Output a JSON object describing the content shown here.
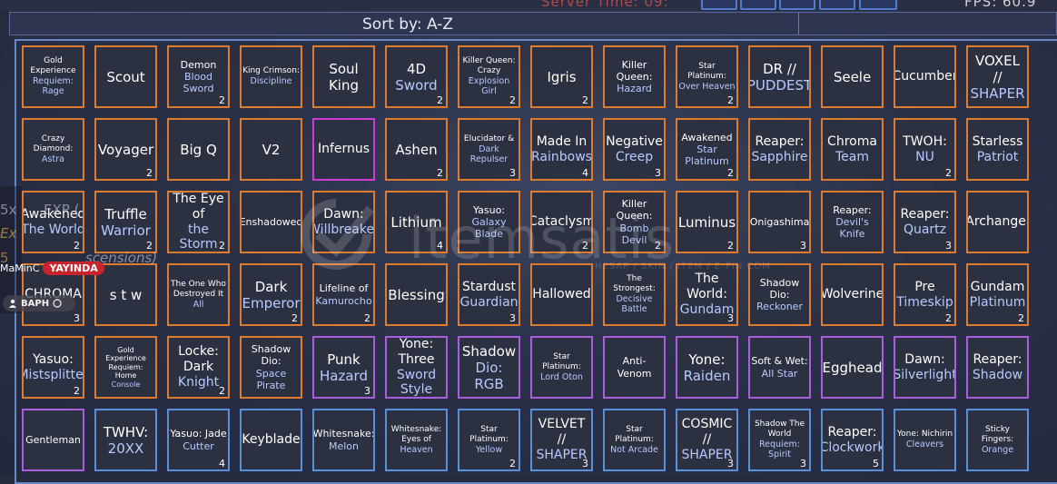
{
  "hud": {
    "server_time": "Server Time: 09:",
    "fps": "FPS: 60.9"
  },
  "sort": {
    "label": "Sort by: A-Z"
  },
  "overlay": {
    "left_lines": [
      "5x",
      "Ex",
      "5"
    ],
    "left_text_1": "EXP (",
    "left_text_2": "scensions)",
    "player_name": "MaMinC",
    "player_badge": "YAYINDA",
    "pill_text": "BAPH"
  },
  "watermark": {
    "brand": "itemsatis",
    "sub": "HESAP / SKIN / ITEM / E-PIN COM"
  },
  "colors": {
    "orange": "#e07a2c",
    "purple": "#a95ee0",
    "magenta": "#d23ad6",
    "blue": "#5b8fd8"
  },
  "tiles": [
    {
      "l1": "Gold Experience",
      "l2": "Requiem: Rage",
      "c": "",
      "b": "orange",
      "s": "xs"
    },
    {
      "l1": "Scout",
      "l2": "",
      "c": "",
      "b": "orange",
      "s": "lg"
    },
    {
      "l1": "Demon",
      "l2": "Blood Sword",
      "c": "2",
      "b": "orange",
      "s": "sm"
    },
    {
      "l1": "King Crimson:",
      "l2": "Discipline",
      "c": "",
      "b": "orange",
      "s": "xs"
    },
    {
      "l1": "Soul King",
      "l2": "",
      "c": "",
      "b": "orange",
      "s": "lg"
    },
    {
      "l1": "4D",
      "l2": "Sword",
      "c": "2",
      "b": "orange",
      "s": "lg"
    },
    {
      "l1": "Killer Queen: Crazy",
      "l2": "Explosion Girl",
      "c": "2",
      "b": "orange",
      "s": "xs"
    },
    {
      "l1": "Igris",
      "l2": "",
      "c": "2",
      "b": "orange",
      "s": "lg"
    },
    {
      "l1": "Killer Queen:",
      "l2": "Hazard",
      "c": "",
      "b": "orange",
      "s": "sm"
    },
    {
      "l1": "Star Platinum:",
      "l2": "Over Heaven",
      "c": "2",
      "b": "orange",
      "s": "xs"
    },
    {
      "l1": "DR //",
      "l2": "PUDDEST",
      "c": "",
      "b": "orange",
      "s": "lg"
    },
    {
      "l1": "Seele",
      "l2": "",
      "c": "",
      "b": "orange",
      "s": "lg"
    },
    {
      "l1": "Cucumber",
      "l2": "",
      "c": "",
      "b": "orange",
      "s": "md"
    },
    {
      "l1": "VOXEL //",
      "l2": "SHAPER",
      "c": "",
      "b": "orange",
      "s": "lg"
    },
    {
      "l1": "Crazy Diamond:",
      "l2": "Astra",
      "c": "",
      "b": "orange",
      "s": "xs"
    },
    {
      "l1": "Voyager",
      "l2": "",
      "c": "2",
      "b": "orange",
      "s": "lg"
    },
    {
      "l1": "Big Q",
      "l2": "",
      "c": "",
      "b": "orange",
      "s": "lg"
    },
    {
      "l1": "V2",
      "l2": "",
      "c": "",
      "b": "orange",
      "s": "lg"
    },
    {
      "l1": "Infernus",
      "l2": "",
      "c": "",
      "b": "magenta",
      "s": "md"
    },
    {
      "l1": "Ashen",
      "l2": "",
      "c": "2",
      "b": "orange",
      "s": "lg"
    },
    {
      "l1": "Elucidator &",
      "l2": "Dark Repulser",
      "c": "3",
      "b": "orange",
      "s": "xs"
    },
    {
      "l1": "Made In",
      "l2": "Rainbows",
      "c": "4",
      "b": "orange",
      "s": "md"
    },
    {
      "l1": "Negative",
      "l2": "Creep",
      "c": "3",
      "b": "orange",
      "s": "md"
    },
    {
      "l1": "Awakened",
      "l2": "Star Platinum",
      "c": "2",
      "b": "orange",
      "s": "sm"
    },
    {
      "l1": "Reaper:",
      "l2": "Sapphire",
      "c": "",
      "b": "orange",
      "s": "md"
    },
    {
      "l1": "Chroma",
      "l2": "Team",
      "c": "",
      "b": "orange",
      "s": "md"
    },
    {
      "l1": "TWOH:",
      "l2": "NU",
      "c": "2",
      "b": "orange",
      "s": "md"
    },
    {
      "l1": "Starless",
      "l2": "Patriot",
      "c": "",
      "b": "orange",
      "s": "md"
    },
    {
      "l1": "Awakened",
      "l2": "The World",
      "c": "2",
      "b": "orange",
      "s": "md"
    },
    {
      "l1": "Truffle",
      "l2": "Warrior",
      "c": "2",
      "b": "orange",
      "s": "lg"
    },
    {
      "l1": "The Eye of",
      "l2": "the Storm",
      "c": "2",
      "b": "orange",
      "s": "md"
    },
    {
      "l1": "Enshadowed",
      "l2": "",
      "c": "",
      "b": "orange",
      "s": "sm"
    },
    {
      "l1": "Dawn:",
      "l2": "Willbreaker",
      "c": "",
      "b": "orange",
      "s": "md"
    },
    {
      "l1": "Lithium",
      "l2": "",
      "c": "4",
      "b": "orange",
      "s": "lg"
    },
    {
      "l1": "Yasuo:",
      "l2": "Galaxy Blade",
      "c": "",
      "b": "orange",
      "s": "sm"
    },
    {
      "l1": "Cataclysm",
      "l2": "",
      "c": "2",
      "b": "orange",
      "s": "md"
    },
    {
      "l1": "Killer Queen:",
      "l2": "Bomb Devil",
      "c": "2",
      "b": "orange",
      "s": "sm"
    },
    {
      "l1": "Luminus",
      "l2": "",
      "c": "2",
      "b": "orange",
      "s": "lg"
    },
    {
      "l1": "Onigashima",
      "l2": "",
      "c": "3",
      "b": "orange",
      "s": "sm"
    },
    {
      "l1": "Reaper:",
      "l2": "Devil's Knife",
      "c": "",
      "b": "orange",
      "s": "sm"
    },
    {
      "l1": "Reaper:",
      "l2": "Quartz",
      "c": "3",
      "b": "orange",
      "s": "md"
    },
    {
      "l1": "Archangel",
      "l2": "",
      "c": "",
      "b": "orange",
      "s": "md"
    },
    {
      "l1": "CHROMA",
      "l2": "",
      "c": "3",
      "b": "orange",
      "s": "md"
    },
    {
      "l1": "s t w",
      "l2": "",
      "c": "",
      "b": "orange",
      "s": "lg"
    },
    {
      "l1": "The One Who Destroyed It",
      "l2": "All",
      "c": "",
      "b": "orange",
      "s": "xs"
    },
    {
      "l1": "Dark",
      "l2": "Emperor",
      "c": "2",
      "b": "orange",
      "s": "lg"
    },
    {
      "l1": "Lifeline of",
      "l2": "Kamurocho",
      "c": "2",
      "b": "orange",
      "s": "sm"
    },
    {
      "l1": "Blessing",
      "l2": "",
      "c": "",
      "b": "orange",
      "s": "lg"
    },
    {
      "l1": "Stardust",
      "l2": "Guardian",
      "c": "3",
      "b": "orange",
      "s": "md"
    },
    {
      "l1": "Hallowed",
      "l2": "",
      "c": "",
      "b": "orange",
      "s": "md"
    },
    {
      "l1": "The Strongest:",
      "l2": "Decisive Battle",
      "c": "",
      "b": "orange",
      "s": "xs"
    },
    {
      "l1": "The World:",
      "l2": "Gundam",
      "c": "3",
      "b": "orange",
      "s": "md"
    },
    {
      "l1": "Shadow Dio:",
      "l2": "Reckoner",
      "c": "",
      "b": "orange",
      "s": "sm"
    },
    {
      "l1": "Wolverine",
      "l2": "",
      "c": "",
      "b": "orange",
      "s": "md"
    },
    {
      "l1": "Pre",
      "l2": "Timeskip",
      "c": "2",
      "b": "orange",
      "s": "md"
    },
    {
      "l1": "Gundam",
      "l2": "Platinum",
      "c": "2",
      "b": "orange",
      "s": "md"
    },
    {
      "l1": "Yasuo:",
      "l2": "Mistsplitter",
      "c": "2",
      "b": "orange",
      "s": "md"
    },
    {
      "l1": "Gold Experience Requiem: Home",
      "l2": "Console",
      "c": "",
      "b": "orange",
      "s": "xxs"
    },
    {
      "l1": "Locke: Dark",
      "l2": "Knight",
      "c": "2",
      "b": "orange",
      "s": "md"
    },
    {
      "l1": "Shadow Dio:",
      "l2": "Space Pirate",
      "c": "",
      "b": "orange",
      "s": "sm"
    },
    {
      "l1": "Punk",
      "l2": "Hazard",
      "c": "3",
      "b": "purple",
      "s": "lg"
    },
    {
      "l1": "Yone: Three",
      "l2": "Sword Style",
      "c": "",
      "b": "purple",
      "s": "md"
    },
    {
      "l1": "Shadow",
      "l2": "Dio: RGB",
      "c": "",
      "b": "purple",
      "s": "lg"
    },
    {
      "l1": "Star Platinum:",
      "l2": "Lord Oton",
      "c": "",
      "b": "purple",
      "s": "xs"
    },
    {
      "l1": "Anti-Venom",
      "l2": "",
      "c": "",
      "b": "purple",
      "s": "sm"
    },
    {
      "l1": "Yone:",
      "l2": "Raiden",
      "c": "",
      "b": "purple",
      "s": "lg"
    },
    {
      "l1": "Soft & Wet:",
      "l2": "All Star",
      "c": "",
      "b": "purple",
      "s": "sm"
    },
    {
      "l1": "Egghead",
      "l2": "",
      "c": "",
      "b": "purple",
      "s": "lg"
    },
    {
      "l1": "Dawn:",
      "l2": "Silverlight",
      "c": "",
      "b": "purple",
      "s": "md"
    },
    {
      "l1": "Reaper:",
      "l2": "Shadow",
      "c": "",
      "b": "purple",
      "s": "md"
    },
    {
      "l1": "Gentleman",
      "l2": "",
      "c": "",
      "b": "purple",
      "s": "sm"
    },
    {
      "l1": "TWHV:",
      "l2": "20XX",
      "c": "",
      "b": "blue",
      "s": "lg"
    },
    {
      "l1": "Yasuo: Jade",
      "l2": "Cutter",
      "c": "4",
      "b": "blue",
      "s": "sm"
    },
    {
      "l1": "Keyblade",
      "l2": "",
      "c": "",
      "b": "blue",
      "s": "md"
    },
    {
      "l1": "Whitesnake:",
      "l2": "Melon",
      "c": "",
      "b": "blue",
      "s": "sm"
    },
    {
      "l1": "Whitesnake: Eyes of",
      "l2": "Heaven",
      "c": "",
      "b": "blue",
      "s": "xs"
    },
    {
      "l1": "Star Platinum:",
      "l2": "Yellow",
      "c": "2",
      "b": "blue",
      "s": "xs"
    },
    {
      "l1": "VELVET //",
      "l2": "SHAPER",
      "c": "3",
      "b": "blue",
      "s": "md"
    },
    {
      "l1": "Star Platinum:",
      "l2": "Not Arcade",
      "c": "",
      "b": "blue",
      "s": "xs"
    },
    {
      "l1": "COSMIC //",
      "l2": "SHAPER",
      "c": "3",
      "b": "blue",
      "s": "md"
    },
    {
      "l1": "Shadow The World",
      "l2": "Requiem: Spirit",
      "c": "3",
      "b": "blue",
      "s": "xs"
    },
    {
      "l1": "Reaper:",
      "l2": "Clockwork",
      "c": "5",
      "b": "blue",
      "s": "md"
    },
    {
      "l1": "Yone: Nichirin",
      "l2": "Cleavers",
      "c": "",
      "b": "blue",
      "s": "xs"
    },
    {
      "l1": "Sticky Fingers:",
      "l2": "Orange",
      "c": "",
      "b": "blue",
      "s": "xs"
    }
  ]
}
